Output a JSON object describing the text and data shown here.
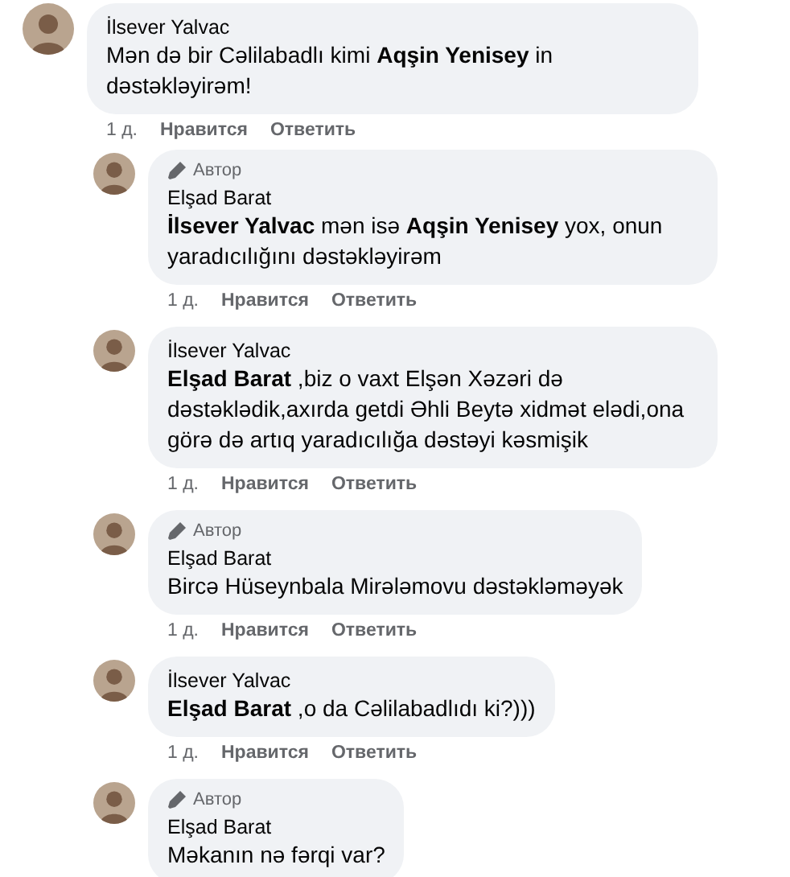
{
  "comments": [
    {
      "author": "İlsever Yalvac",
      "text": "Mən də bir Cəlilabadlı kimi **Aqşin Yenisey** in dəstəkləyirəm!",
      "meta": {
        "time": "1 д.",
        "like": "Нравится",
        "reply": "Ответить"
      },
      "replies": [
        {
          "badge": "Автор",
          "author": "Elşad Barat",
          "text": "**İlsever Yalvac** mən isə **Aqşin Yenisey** yox, onun yaradıcılığını dəstəkləyirəm",
          "meta": {
            "time": "1 д.",
            "like": "Нравится",
            "reply": "Ответить"
          }
        },
        {
          "author": "İlsever Yalvac",
          "text": "**Elşad Barat** ,biz o vaxt Elşən Xəzəri də dəstəklədik,axırda getdi Əhli Beytə xidmət elədi,ona görə də artıq yaradıcılığa dəstəyi kəsmişik",
          "meta": {
            "time": "1 д.",
            "like": "Нравится",
            "reply": "Ответить"
          }
        },
        {
          "badge": "Автор",
          "author": "Elşad Barat",
          "text": "Bircə Hüseynbala Mirələmovu dəstəkləməyək",
          "meta": {
            "time": "1 д.",
            "like": "Нравится",
            "reply": "Ответить"
          }
        },
        {
          "author": "İlsever Yalvac",
          "text": "**Elşad Barat** ,o da Cəlilabadlıdı ki?)))",
          "meta": {
            "time": "1 д.",
            "like": "Нравится",
            "reply": "Ответить"
          }
        },
        {
          "badge": "Автор",
          "author": "Elşad Barat",
          "text": "Məkanın nə fərqi var?"
        }
      ]
    }
  ]
}
